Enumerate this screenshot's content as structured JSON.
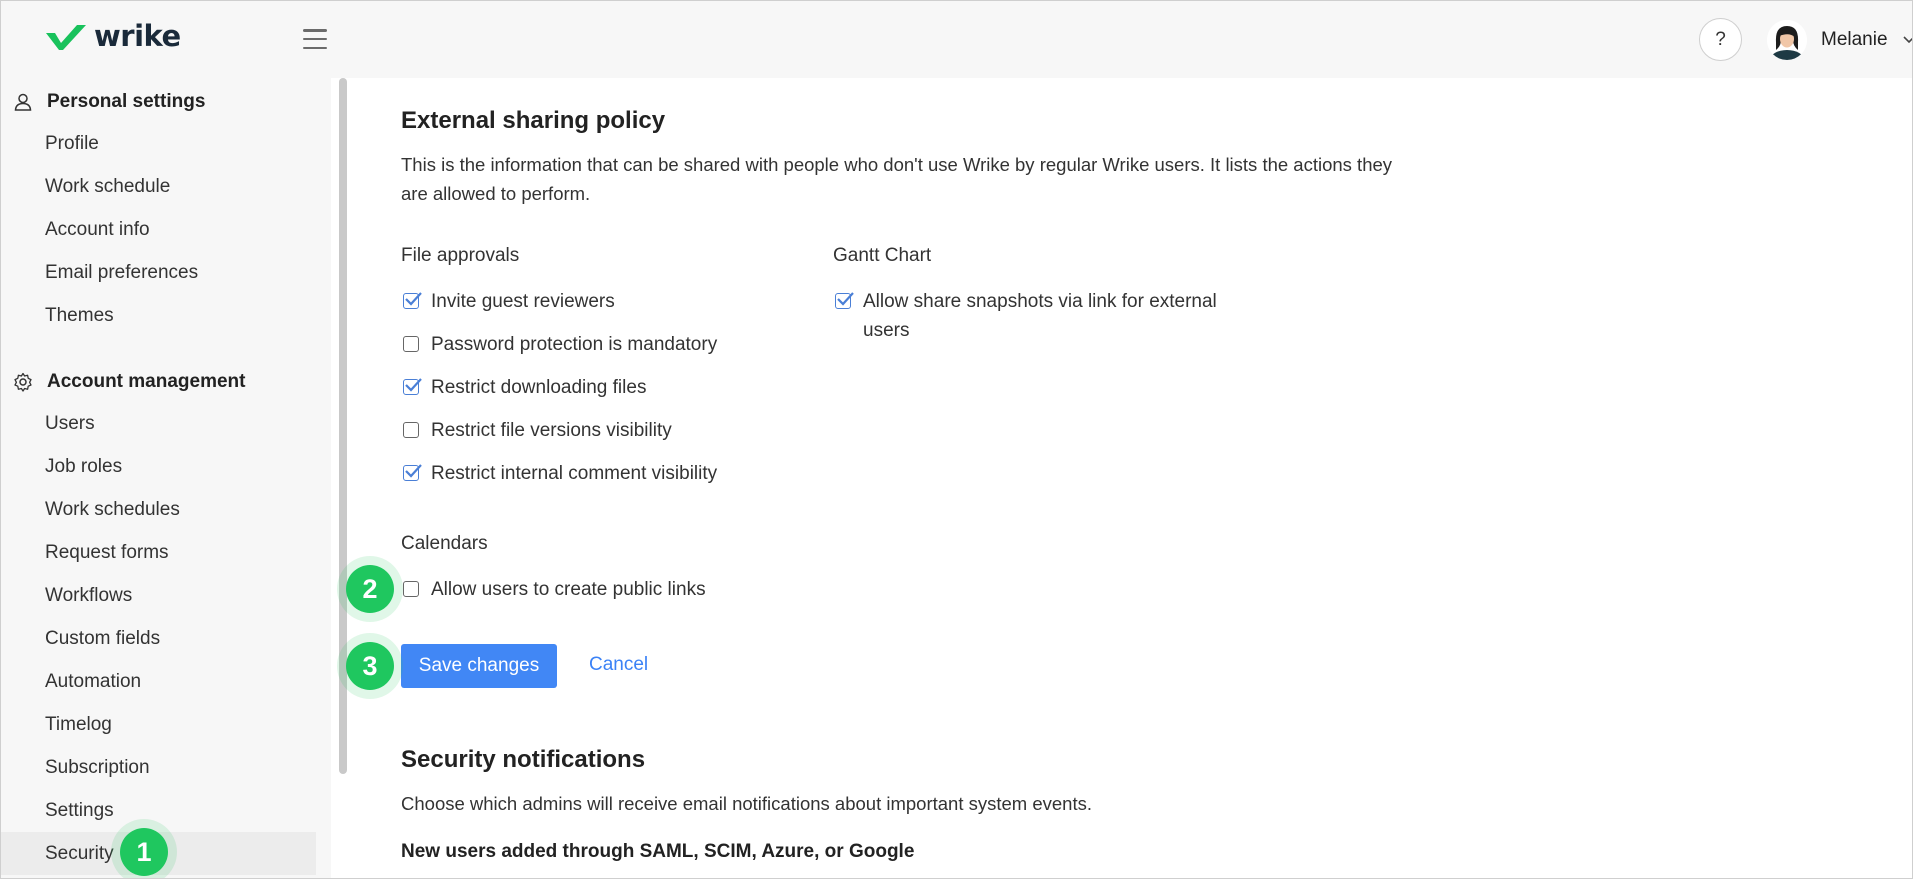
{
  "app": {
    "logo_text": "wrike"
  },
  "header": {
    "help_label": "?",
    "user_name": "Melanie"
  },
  "sidebar": {
    "personal_title": "Personal settings",
    "personal_items": [
      "Profile",
      "Work schedule",
      "Account info",
      "Email preferences",
      "Themes"
    ],
    "account_title": "Account management",
    "account_items": [
      "Users",
      "Job roles",
      "Work schedules",
      "Request forms",
      "Workflows",
      "Custom fields",
      "Automation",
      "Timelog",
      "Subscription",
      "Settings",
      "Security"
    ],
    "active_item": "Security"
  },
  "main": {
    "sharing": {
      "title": "External sharing policy",
      "description_line1": "This is the information that can be shared with people who don't use Wrike by regular Wrike users. It lists the actions they",
      "description_line2": "are allowed to perform.",
      "file_approvals": {
        "label": "File approvals",
        "options": [
          {
            "label": "Invite guest reviewers",
            "checked": true
          },
          {
            "label": "Password protection is mandatory",
            "checked": false
          },
          {
            "label": "Restrict downloading files",
            "checked": true
          },
          {
            "label": "Restrict file versions visibility",
            "checked": false
          },
          {
            "label": "Restrict internal comment visibility",
            "checked": true
          }
        ]
      },
      "gantt": {
        "label": "Gantt Chart",
        "option_line1": "Allow share snapshots via link for external",
        "option_line2": "users",
        "checked": true
      },
      "calendars": {
        "label": "Calendars",
        "option": "Allow users to create public links",
        "checked": false
      },
      "save_label": "Save changes",
      "cancel_label": "Cancel"
    },
    "security_notifications": {
      "title": "Security notifications",
      "description": "Choose which admins will receive email notifications about important system events.",
      "subheading": "New users added through SAML, SCIM, Azure, or Google"
    }
  },
  "markers": [
    "1",
    "2",
    "3"
  ],
  "colors": {
    "accent": "#4187f5",
    "marker": "#1fc75f",
    "brand": "#19c25c"
  }
}
